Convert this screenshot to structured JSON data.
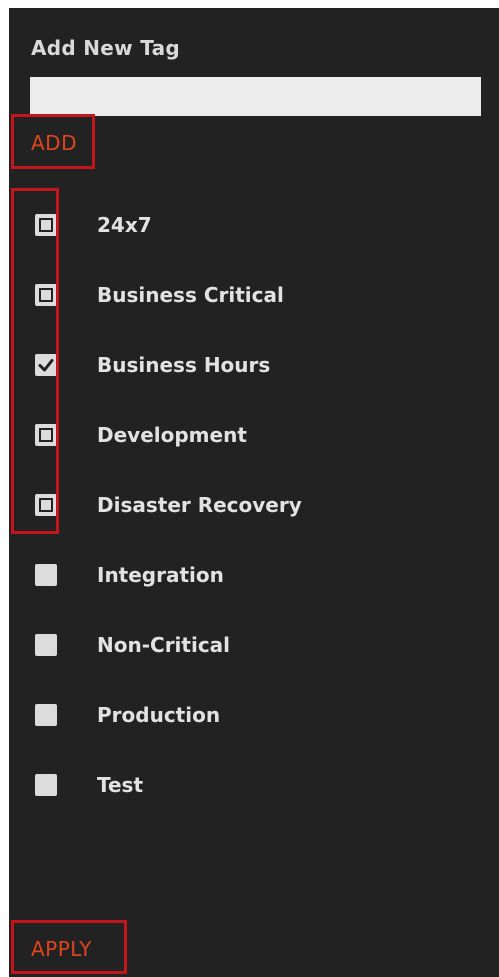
{
  "panel": {
    "title": "Add New Tag",
    "input": {
      "value": "",
      "placeholder": ""
    },
    "add_label": "ADD",
    "apply_label": "APPLY"
  },
  "tags": [
    {
      "label": "24x7",
      "checked": false,
      "style": "outlined"
    },
    {
      "label": "Business Critical",
      "checked": false,
      "style": "outlined"
    },
    {
      "label": "Business Hours",
      "checked": true,
      "style": "outlined"
    },
    {
      "label": "Development",
      "checked": false,
      "style": "outlined"
    },
    {
      "label": "Disaster Recovery",
      "checked": false,
      "style": "outlined"
    },
    {
      "label": "Integration",
      "checked": false,
      "style": "plain"
    },
    {
      "label": "Non-Critical",
      "checked": false,
      "style": "plain"
    },
    {
      "label": "Production",
      "checked": false,
      "style": "plain"
    },
    {
      "label": "Test",
      "checked": false,
      "style": "plain"
    }
  ],
  "colors": {
    "panel_background": "#222222",
    "accent": "#e0441c",
    "highlight_border": "#c3151a",
    "text": "#e2e2e2"
  }
}
